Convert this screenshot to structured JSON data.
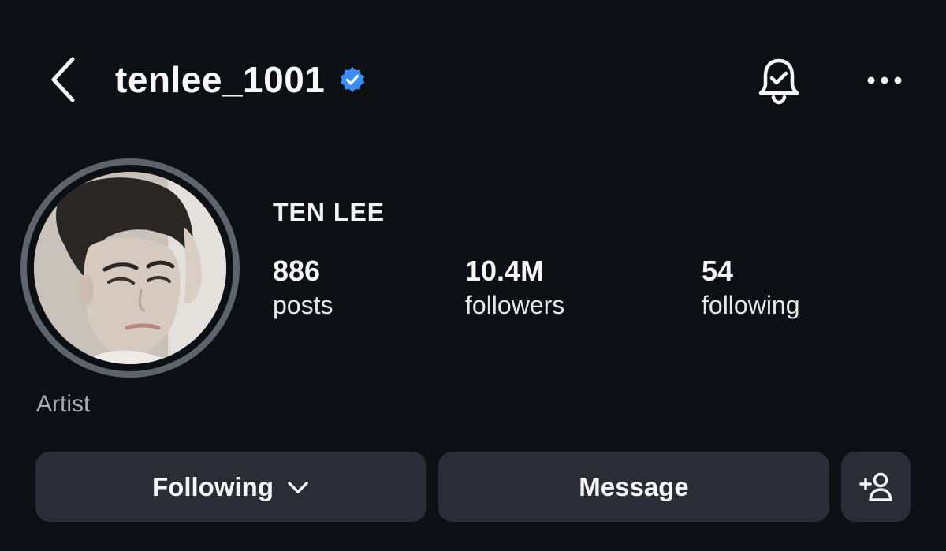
{
  "header": {
    "username": "tenlee_1001",
    "verified": true,
    "back_icon": "chevron-left-icon",
    "verified_icon": "verified-badge-icon",
    "bell_icon": "notification-bell-check-icon",
    "more_icon": "more-horizontal-icon"
  },
  "profile": {
    "display_name": "TEN LEE",
    "category": "Artist",
    "avatar_icon": "profile-photo"
  },
  "stats": {
    "posts": {
      "value": "886",
      "label": "posts"
    },
    "followers": {
      "value": "10.4M",
      "label": "followers"
    },
    "following": {
      "value": "54",
      "label": "following"
    }
  },
  "actions": {
    "following_label": "Following",
    "following_icon": "chevron-down-icon",
    "message_label": "Message",
    "add_user_icon": "add-user-icon"
  },
  "colors": {
    "background": "#0c0f14",
    "button_bg": "#2a2d35",
    "verified_blue": "#3b8cf5",
    "ring": "#5f636c",
    "muted_text": "#a6a9b0"
  }
}
